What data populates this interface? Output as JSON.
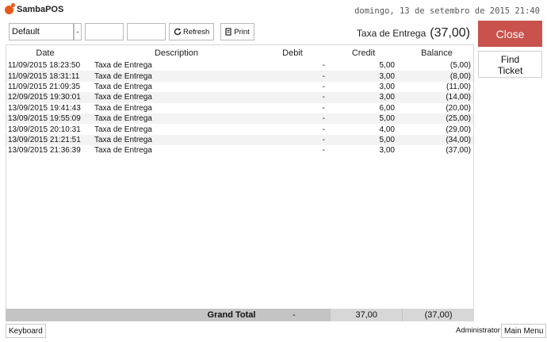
{
  "app": {
    "name": "SambaPOS",
    "datetime": "domingo, 13 de setembro de 2015 21:40"
  },
  "filters": {
    "selected": "Default",
    "date_from": "",
    "date_to": "",
    "refresh_label": "Refresh",
    "print_label": "Print"
  },
  "account": {
    "name": "Taxa de Entrega",
    "balance": "(37,00)"
  },
  "buttons": {
    "close": "Close",
    "find_line1": "Find",
    "find_line2": "Ticket",
    "keyboard": "Keyboard",
    "main_menu": "Main Menu"
  },
  "user": {
    "name": "Administrator"
  },
  "table": {
    "headers": {
      "date": "Date",
      "description": "Description",
      "debit": "Debit",
      "credit": "Credit",
      "balance": "Balance"
    },
    "rows": [
      {
        "date": "11/09/2015 18:23:50",
        "description": "Taxa de Entrega",
        "debit": "-",
        "credit": "5,00",
        "balance": "(5,00)"
      },
      {
        "date": "11/09/2015 18:31:11",
        "description": "Taxa de Entrega",
        "debit": "-",
        "credit": "3,00",
        "balance": "(8,00)"
      },
      {
        "date": "11/09/2015 21:09:35",
        "description": "Taxa de Entrega",
        "debit": "-",
        "credit": "3,00",
        "balance": "(11,00)"
      },
      {
        "date": "12/09/2015 19:30:01",
        "description": "Taxa de Entrega",
        "debit": "-",
        "credit": "3,00",
        "balance": "(14,00)"
      },
      {
        "date": "13/09/2015 19:41:43",
        "description": "Taxa de Entrega",
        "debit": "-",
        "credit": "6,00",
        "balance": "(20,00)"
      },
      {
        "date": "13/09/2015 19:55:09",
        "description": "Taxa de Entrega",
        "debit": "-",
        "credit": "5,00",
        "balance": "(25,00)"
      },
      {
        "date": "13/09/2015 20:10:31",
        "description": "Taxa de Entrega",
        "debit": "-",
        "credit": "4,00",
        "balance": "(29,00)"
      },
      {
        "date": "13/09/2015 21:21:51",
        "description": "Taxa de Entrega",
        "debit": "-",
        "credit": "5,00",
        "balance": "(34,00)"
      },
      {
        "date": "13/09/2015 21:36:39",
        "description": "Taxa de Entrega",
        "debit": "-",
        "credit": "3,00",
        "balance": "(37,00)"
      }
    ],
    "totals": {
      "label": "Grand Total",
      "debit": "-",
      "credit": "37,00",
      "balance": "(37,00)"
    }
  },
  "colors": {
    "close_button": "#c9524c",
    "logo": "#e8591a",
    "totals_bar": "#c4c4c4"
  }
}
